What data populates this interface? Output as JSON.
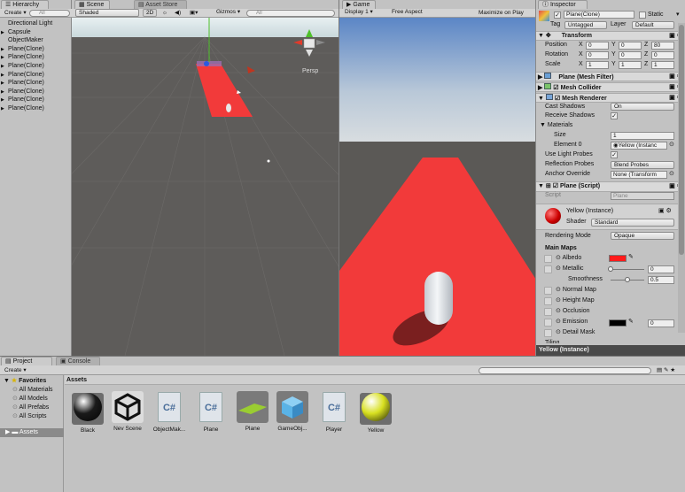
{
  "hierarchy": {
    "tab": "Hierarchy",
    "create": "Create",
    "search": "All",
    "items": [
      {
        "label": "Directional Light",
        "arrow": ""
      },
      {
        "label": "Capsule",
        "arrow": "▶"
      },
      {
        "label": "ObjectMaker",
        "arrow": ""
      },
      {
        "label": "Plane(Clone)",
        "arrow": "▶"
      },
      {
        "label": "Plane(Clone)",
        "arrow": "▶"
      },
      {
        "label": "Plane(Clone)",
        "arrow": "▶"
      },
      {
        "label": "Plane(Clone)",
        "arrow": "▶"
      },
      {
        "label": "Plane(Clone)",
        "arrow": "▶"
      },
      {
        "label": "Plane(Clone)",
        "arrow": "▶"
      },
      {
        "label": "Plane(Clone)",
        "arrow": "▶"
      },
      {
        "label": "Plane(Clone)",
        "arrow": "▶"
      }
    ]
  },
  "scene": {
    "tab": "Scene",
    "store_tab": "Asset Store",
    "shading": "Shaded",
    "mode2d": "2D",
    "gizmos": "Gizmos",
    "search": "All",
    "persp": "Persp"
  },
  "game": {
    "tab": "Game",
    "display": "Display 1",
    "aspect": "Free Aspect",
    "maximize": "Maximize on Play"
  },
  "inspector": {
    "tab": "Inspector",
    "object_name": "Plane(Clone)",
    "static_label": "Static",
    "tag_label": "Tag",
    "tag": "Untagged",
    "layer_label": "Layer",
    "layer": "Default",
    "transform": {
      "title": "Transform",
      "position_label": "Position",
      "rotation_label": "Rotation",
      "scale_label": "Scale",
      "position": [
        "0",
        "0",
        "80"
      ],
      "rotation": [
        "0",
        "0",
        "0"
      ],
      "scale": [
        "1",
        "1",
        "1"
      ],
      "axes": [
        "X",
        "Y",
        "Z"
      ]
    },
    "mesh_filter": "Plane (Mesh Filter)",
    "mesh_collider": "Mesh Collider",
    "mesh_renderer": {
      "title": "Mesh Renderer",
      "cast_shadows_label": "Cast Shadows",
      "cast_shadows": "On",
      "receive_shadows_label": "Receive Shadows",
      "materials_label": "Materials",
      "size_label": "Size",
      "size": "1",
      "element0_label": "Element 0",
      "element0": "Yellow (Instanc",
      "light_probes_label": "Use Light Probes",
      "reflection_probes_label": "Reflection Probes",
      "reflection_probes": "Blend Probes",
      "anchor_label": "Anchor Override",
      "anchor": "None (Transform"
    },
    "script": {
      "title": "Plane (Script)",
      "script_label": "Script",
      "script_value": "Plane"
    },
    "material": {
      "name": "Yellow (Instance)",
      "shader_label": "Shader",
      "shader": "Standard",
      "rendering_mode_label": "Rendering Mode",
      "rendering_mode": "Opaque",
      "main_maps_label": "Main Maps",
      "albedo_label": "Albedo",
      "albedo_color": "#ff1a1a",
      "metallic_label": "Metallic",
      "metallic": "0",
      "smoothness_label": "Smoothness",
      "smoothness": "0.5",
      "smoothness_level": 0.5,
      "normal_label": "Normal Map",
      "height_label": "Height Map",
      "occlusion_label": "Occlusion",
      "emission_label": "Emission",
      "emission": "0",
      "emission_color": "#000000",
      "detail_label": "Detail Mask",
      "tiling_label": "Tiling"
    },
    "preview_label": "Yellow (Instance)"
  },
  "project": {
    "tab": "Project",
    "console_tab": "Console",
    "create": "Create",
    "favorites": "Favorites",
    "fav_items": [
      "All Materials",
      "All Models",
      "All Prefabs",
      "All Scripts"
    ],
    "assets_root": "Assets",
    "breadcrumb": "Assets",
    "assets": [
      {
        "name": "Black",
        "kind": "sphere",
        "color": "#1a1a1a"
      },
      {
        "name": "Nev Scene",
        "kind": "unity",
        "color": "#111111"
      },
      {
        "name": "ObjectMak...",
        "kind": "script",
        "color": "#dfe4ea"
      },
      {
        "name": "Plane",
        "kind": "script",
        "color": "#dfe4ea"
      },
      {
        "name": "Plane",
        "kind": "plane",
        "color": "#9acd32"
      },
      {
        "name": "GameObj...",
        "kind": "cube",
        "color": "#5ab3e6"
      },
      {
        "name": "Player",
        "kind": "script",
        "color": "#dfe4ea"
      },
      {
        "name": "Yellow",
        "kind": "sphere",
        "color": "#d8e020"
      }
    ]
  }
}
